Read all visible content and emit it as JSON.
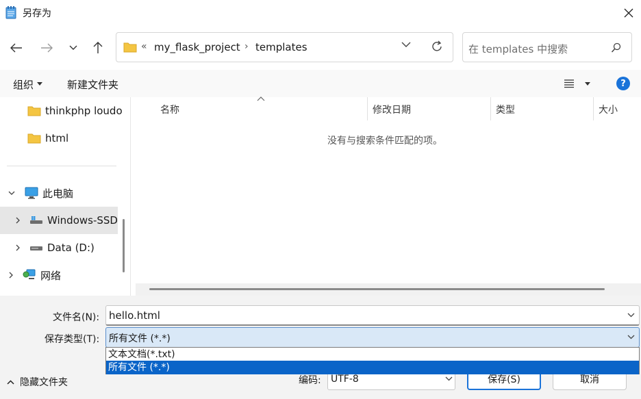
{
  "window": {
    "title": "另存为"
  },
  "address": {
    "prefix": "«",
    "segments": [
      "my_flask_project",
      "templates"
    ],
    "separator": "›"
  },
  "search": {
    "placeholder": "在 templates 中搜索"
  },
  "toolbar": {
    "organize_label": "组织",
    "new_folder_label": "新建文件夹",
    "help_label": "?"
  },
  "sidebar": {
    "items": [
      {
        "label": "thinkphp loudo",
        "icon": "folder-icon"
      },
      {
        "label": "html",
        "icon": "folder-icon"
      },
      {
        "label": "此电脑",
        "icon": "computer-icon",
        "expanded": true
      },
      {
        "label": "Windows-SSD",
        "icon": "drive-icon",
        "selected": true
      },
      {
        "label": "Data (D:)",
        "icon": "drive-icon"
      },
      {
        "label": "网络",
        "icon": "network-icon"
      }
    ]
  },
  "filelist": {
    "columns": [
      "名称",
      "修改日期",
      "类型",
      "大小"
    ],
    "empty_message": "没有与搜索条件匹配的项。"
  },
  "form": {
    "filename_label": "文件名(N):",
    "filename_value": "hello.html",
    "filetype_label": "保存类型(T):",
    "filetype_value": "所有文件  (*.*)",
    "filetype_options": [
      "文本文档(*.txt)",
      "所有文件  (*.*)"
    ],
    "filetype_selected_index": 1,
    "hide_folders_label": "隐藏文件夹",
    "encoding_label": "编码:",
    "encoding_value": "UTF-8",
    "save_label": "保存(S)",
    "cancel_label": "取消"
  },
  "colors": {
    "accent": "#1a73d9",
    "selection": "#0a64c8",
    "folder": "#f4c542"
  }
}
